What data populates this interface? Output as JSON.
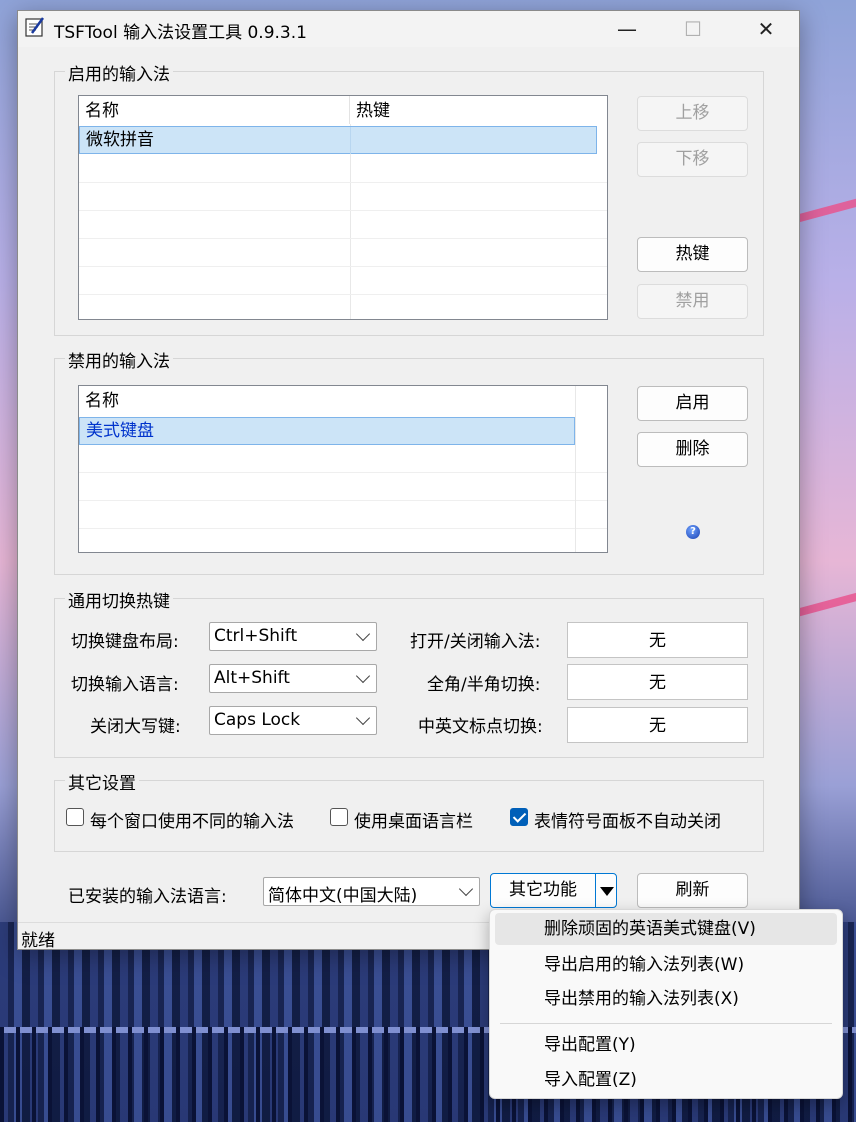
{
  "window": {
    "title": "TSFTool 输入法设置工具 0.9.3.1",
    "controls": {
      "minimize": "—",
      "maximize": "☐",
      "close": "✕"
    }
  },
  "enabled_group": {
    "title": "启用的输入法",
    "columns": [
      "名称",
      "热键"
    ],
    "rows": [
      {
        "name": "微软拼音",
        "hotkey": ""
      }
    ],
    "buttons": {
      "move_up": "上移",
      "move_down": "下移",
      "hotkey": "热键",
      "disable": "禁用"
    }
  },
  "disabled_group": {
    "title": "禁用的输入法",
    "columns": [
      "名称"
    ],
    "rows": [
      {
        "name": "美式键盘"
      }
    ],
    "buttons": {
      "enable": "启用",
      "delete": "删除"
    },
    "help_icon": "?"
  },
  "hotkey_group": {
    "title": "通用切换热键",
    "switch_layout_label": "切换键盘布局:",
    "switch_layout_value": "Ctrl+Shift",
    "switch_language_label": "切换输入语言:",
    "switch_language_value": "Alt+Shift",
    "caps_lock_label": "关闭大写键:",
    "caps_lock_value": "Caps Lock",
    "toggle_ime_label": "打开/关闭输入法:",
    "toggle_ime_value": "无",
    "full_half_label": "全角/半角切换:",
    "full_half_value": "无",
    "punct_label": "中英文标点切换:",
    "punct_value": "无"
  },
  "other_group": {
    "title": "其它设置",
    "per_window_label": "每个窗口使用不同的输入法",
    "per_window_checked": false,
    "desktop_bar_label": "使用桌面语言栏",
    "desktop_bar_checked": false,
    "emoji_panel_label": "表情符号面板不自动关闭",
    "emoji_panel_checked": true
  },
  "bottom": {
    "installed_lang_label": "已安装的输入法语言:",
    "installed_lang_value": "简体中文(中国大陆)",
    "other_functions": "其它功能",
    "refresh": "刷新"
  },
  "status": {
    "text": "就绪"
  },
  "menu": {
    "items": [
      {
        "label": "删除顽固的英语美式键盘(V)"
      },
      {
        "label": "导出启用的输入法列表(W)"
      },
      {
        "label": "导出禁用的输入法列表(X)"
      },
      {
        "label": "导出配置(Y)"
      },
      {
        "label": "导入配置(Z)"
      }
    ]
  },
  "colors": {
    "accent": "#0078d4",
    "selection": "#cce4f7",
    "checkbox": "#005fb8"
  }
}
